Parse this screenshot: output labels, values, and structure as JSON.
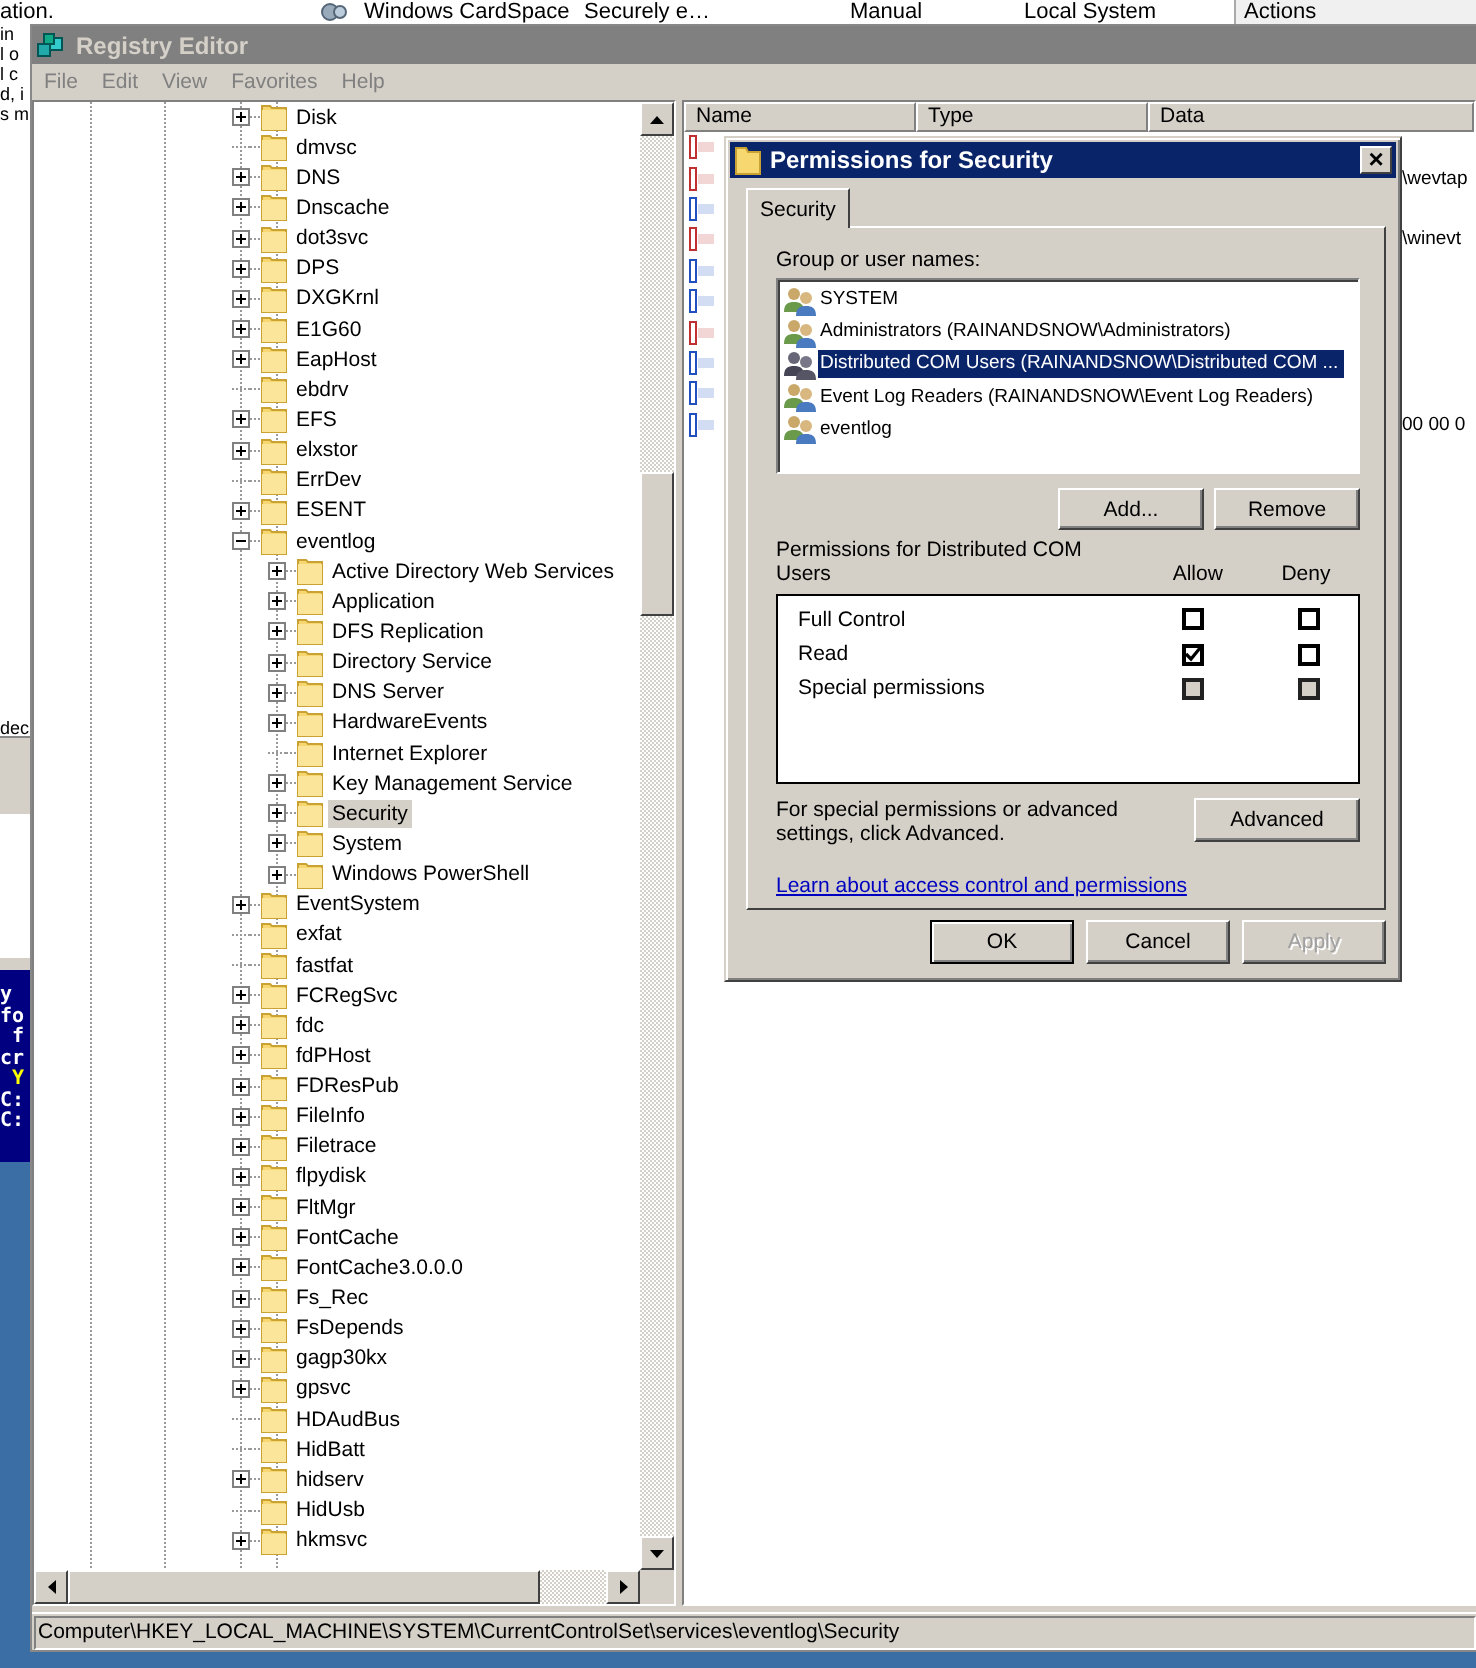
{
  "background": {
    "top_strip": {
      "left_fragment": "ation.",
      "service_name": "Windows CardSpace",
      "service_description": "Securely e…",
      "startup_type": "Manual",
      "log_on_as": "Local System",
      "actions_title": "Actions"
    },
    "left_fragments": [
      "in",
      "l o",
      "l c",
      "d, i",
      "s m"
    ],
    "dialog_fragment": "dec",
    "console_lines": [
      "y",
      "fo",
      " f",
      "cr",
      " Y",
      "C:",
      "C:"
    ]
  },
  "window": {
    "title": "Registry Editor"
  },
  "menu": [
    "File",
    "Edit",
    "View",
    "Favorites",
    "Help"
  ],
  "tree": {
    "items": [
      {
        "label": "Disk",
        "expandable": true,
        "expanded": false,
        "selected": false
      },
      {
        "label": "dmvsc",
        "expandable": false,
        "selected": false
      },
      {
        "label": "DNS",
        "expandable": true,
        "expanded": false,
        "selected": false
      },
      {
        "label": "Dnscache",
        "expandable": true,
        "expanded": false,
        "selected": false
      },
      {
        "label": "dot3svc",
        "expandable": true,
        "expanded": false,
        "selected": false
      },
      {
        "label": "DPS",
        "expandable": true,
        "expanded": false,
        "selected": false
      },
      {
        "label": "DXGKrnl",
        "expandable": true,
        "expanded": false,
        "selected": false
      },
      {
        "label": "E1G60",
        "expandable": true,
        "expanded": false,
        "selected": false
      },
      {
        "label": "EapHost",
        "expandable": true,
        "expanded": false,
        "selected": false
      },
      {
        "label": "ebdrv",
        "expandable": false,
        "selected": false
      },
      {
        "label": "EFS",
        "expandable": true,
        "expanded": false,
        "selected": false
      },
      {
        "label": "elxstor",
        "expandable": true,
        "expanded": false,
        "selected": false
      },
      {
        "label": "ErrDev",
        "expandable": false,
        "selected": false
      },
      {
        "label": "ESENT",
        "expandable": true,
        "expanded": false,
        "selected": false
      },
      {
        "label": "eventlog",
        "expandable": true,
        "expanded": true,
        "selected": false,
        "children": [
          {
            "label": "Active Directory Web Services",
            "expandable": true,
            "expanded": false,
            "selected": false
          },
          {
            "label": "Application",
            "expandable": true,
            "expanded": false,
            "selected": false
          },
          {
            "label": "DFS Replication",
            "expandable": true,
            "expanded": false,
            "selected": false
          },
          {
            "label": "Directory Service",
            "expandable": true,
            "expanded": false,
            "selected": false
          },
          {
            "label": "DNS Server",
            "expandable": true,
            "expanded": false,
            "selected": false
          },
          {
            "label": "HardwareEvents",
            "expandable": true,
            "expanded": false,
            "selected": false
          },
          {
            "label": "Internet Explorer",
            "expandable": false,
            "selected": false
          },
          {
            "label": "Key Management Service",
            "expandable": true,
            "expanded": false,
            "selected": false
          },
          {
            "label": "Security",
            "expandable": true,
            "expanded": false,
            "selected": true
          },
          {
            "label": "System",
            "expandable": true,
            "expanded": false,
            "selected": false
          },
          {
            "label": "Windows PowerShell",
            "expandable": true,
            "expanded": false,
            "selected": false
          }
        ]
      },
      {
        "label": "EventSystem",
        "expandable": true,
        "expanded": false,
        "selected": false
      },
      {
        "label": "exfat",
        "expandable": false,
        "selected": false
      },
      {
        "label": "fastfat",
        "expandable": false,
        "selected": false
      },
      {
        "label": "FCRegSvc",
        "expandable": true,
        "expanded": false,
        "selected": false
      },
      {
        "label": "fdc",
        "expandable": true,
        "expanded": false,
        "selected": false
      },
      {
        "label": "fdPHost",
        "expandable": true,
        "expanded": false,
        "selected": false
      },
      {
        "label": "FDResPub",
        "expandable": true,
        "expanded": false,
        "selected": false
      },
      {
        "label": "FileInfo",
        "expandable": true,
        "expanded": false,
        "selected": false
      },
      {
        "label": "Filetrace",
        "expandable": true,
        "expanded": false,
        "selected": false
      },
      {
        "label": "flpydisk",
        "expandable": true,
        "expanded": false,
        "selected": false
      },
      {
        "label": "FltMgr",
        "expandable": true,
        "expanded": false,
        "selected": false
      },
      {
        "label": "FontCache",
        "expandable": true,
        "expanded": false,
        "selected": false
      },
      {
        "label": "FontCache3.0.0.0",
        "expandable": true,
        "expanded": false,
        "selected": false
      },
      {
        "label": "Fs_Rec",
        "expandable": true,
        "expanded": false,
        "selected": false
      },
      {
        "label": "FsDepends",
        "expandable": true,
        "expanded": false,
        "selected": false
      },
      {
        "label": "gagp30kx",
        "expandable": true,
        "expanded": false,
        "selected": false
      },
      {
        "label": "gpsvc",
        "expandable": true,
        "expanded": false,
        "selected": false
      },
      {
        "label": "HDAudBus",
        "expandable": false,
        "selected": false
      },
      {
        "label": "HidBatt",
        "expandable": false,
        "selected": false
      },
      {
        "label": "hidserv",
        "expandable": true,
        "expanded": false,
        "selected": false
      },
      {
        "label": "HidUsb",
        "expandable": false,
        "selected": false
      },
      {
        "label": "hkmsvc",
        "expandable": true,
        "expanded": false,
        "selected": false
      }
    ]
  },
  "values": {
    "columns": [
      "Name",
      "Type",
      "Data"
    ],
    "rows": [
      {
        "kind": "string"
      },
      {
        "kind": "string",
        "data": "\\wevtap"
      },
      {
        "kind": "binary"
      },
      {
        "kind": "string",
        "data": "\\winevt"
      },
      {
        "kind": "binary"
      },
      {
        "kind": "binary"
      },
      {
        "kind": "string"
      },
      {
        "kind": "binary"
      },
      {
        "kind": "binary"
      },
      {
        "kind": "binary",
        "data": "00 00 0"
      }
    ]
  },
  "status_bar": "Computer\\HKEY_LOCAL_MACHINE\\SYSTEM\\CurrentControlSet\\services\\eventlog\\Security",
  "dialog": {
    "title": "Permissions for Security",
    "close": "×",
    "tabs": [
      {
        "label": "Security",
        "selected": true
      }
    ],
    "group_label": "Group or user names:",
    "users": [
      {
        "name": "SYSTEM",
        "selected": false
      },
      {
        "name": "Administrators (RAINANDSNOW\\Administrators)",
        "selected": false
      },
      {
        "name": "Distributed COM Users (RAINANDSNOW\\Distributed COM ...",
        "selected": true
      },
      {
        "name": "Event Log Readers (RAINANDSNOW\\Event Log Readers)",
        "selected": false
      },
      {
        "name": "eventlog",
        "selected": false
      }
    ],
    "user_buttons": [
      "Add...",
      "Remove"
    ],
    "permissions_label": "Permissions for Distributed COM Users",
    "allow_header": "Allow",
    "deny_header": "Deny",
    "permissions": [
      {
        "name": "Full Control",
        "allow": false,
        "deny": false,
        "disabled": false
      },
      {
        "name": "Read",
        "allow": true,
        "deny": false,
        "disabled": false
      },
      {
        "name": "Special permissions",
        "allow": false,
        "deny": false,
        "disabled": true
      }
    ],
    "advanced_note": "For special permissions or advanced settings, click Advanced.",
    "advanced_button": "Advanced",
    "link": "Learn about access control and permissions",
    "buttons": [
      {
        "label": "OK",
        "disabled": false
      },
      {
        "label": "Cancel",
        "disabled": false
      },
      {
        "label": "Apply",
        "disabled": true
      }
    ]
  }
}
